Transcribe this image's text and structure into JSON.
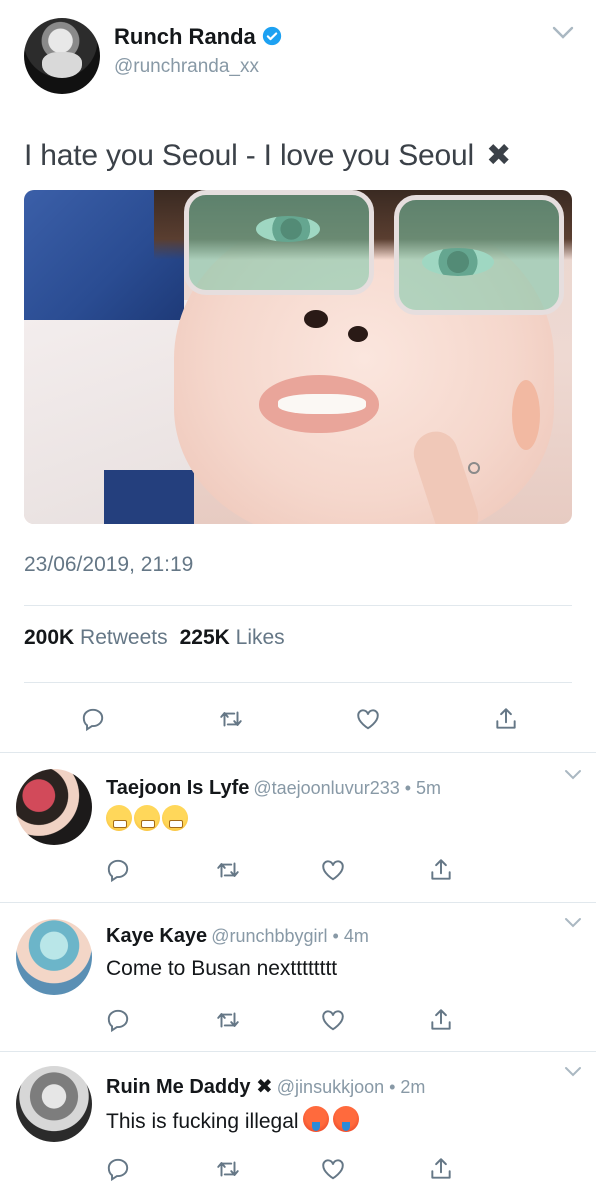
{
  "tweet": {
    "author_name": "Runch Randa",
    "author_handle": "@runchranda_xx",
    "text": "I hate you Seoul - I love you Seoul",
    "text_suffix": "✖",
    "timestamp": "23/06/2019, 21:19",
    "retweets_count": "200K",
    "retweets_label": "Retweets",
    "likes_count": "225K",
    "likes_label": "Likes"
  },
  "replies": [
    {
      "name": "Taejoon Is Lyfe",
      "handle": "@taejoonluvur233 • 5m",
      "text": ""
    },
    {
      "name": "Kaye Kaye",
      "handle": "@runchbbygirl • 4m",
      "text": "Come to Busan nextttttttt"
    },
    {
      "name": "Ruin Me Daddy ✖",
      "handle": "@jinsukkjoon • 2m",
      "text": "This is fucking illegal"
    }
  ],
  "colors": {
    "accent": "#1da1f2",
    "text": "#14171a",
    "secondary": "#657786",
    "divider": "#e1e8ed"
  }
}
